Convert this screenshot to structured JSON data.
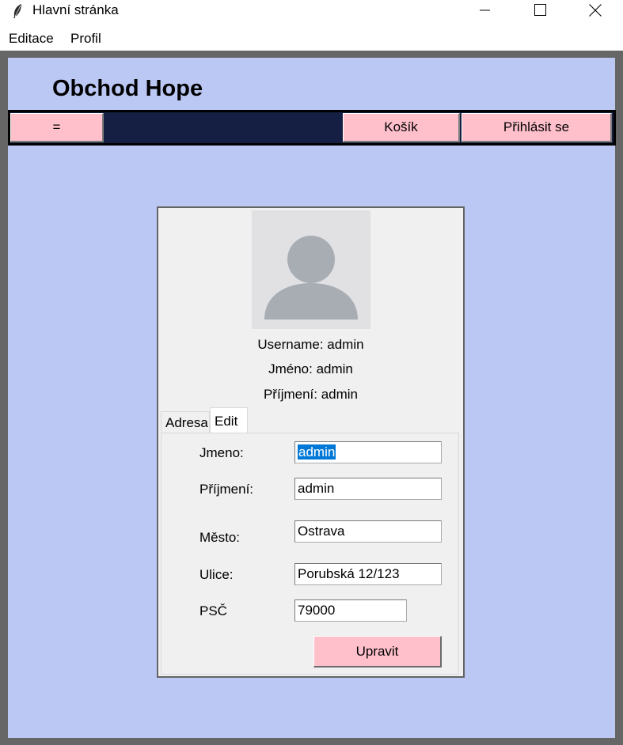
{
  "window": {
    "title": "Hlavní stránka",
    "icon": "feather-icon",
    "controls": [
      "minimize-icon",
      "maximize-icon",
      "close-icon"
    ]
  },
  "menu": {
    "items": [
      {
        "label": "Editace"
      },
      {
        "label": "Profil"
      }
    ]
  },
  "header": {
    "title": "Obchod Hope"
  },
  "nav": {
    "menu_label": "=",
    "cart_label": "Košík",
    "login_label": "Přihlásit se"
  },
  "profile": {
    "avatar": "user-avatar-icon",
    "username_line": "Username: admin",
    "name_line": "Jméno: admin",
    "surname_line": "Příjmení: admin"
  },
  "tabs": [
    {
      "label": "Adresa",
      "active": false
    },
    {
      "label": "Edit",
      "active": true
    }
  ],
  "form": {
    "fields": [
      {
        "label": "Jmeno:",
        "value": "admin"
      },
      {
        "label": "Příjmení:",
        "value": "admin"
      },
      {
        "label": "Město:",
        "value": "Ostrava"
      },
      {
        "label": "Ulice:",
        "value": "Porubská 12/123"
      },
      {
        "label": "PSČ",
        "value": "79000"
      }
    ],
    "submit_label": "Upravit"
  },
  "colors": {
    "panel_bg": "#bcc8f4",
    "nav_bg": "#151f44",
    "button_bg": "#ffc0cb",
    "frame": "#666666",
    "selection": "#0078d7"
  }
}
